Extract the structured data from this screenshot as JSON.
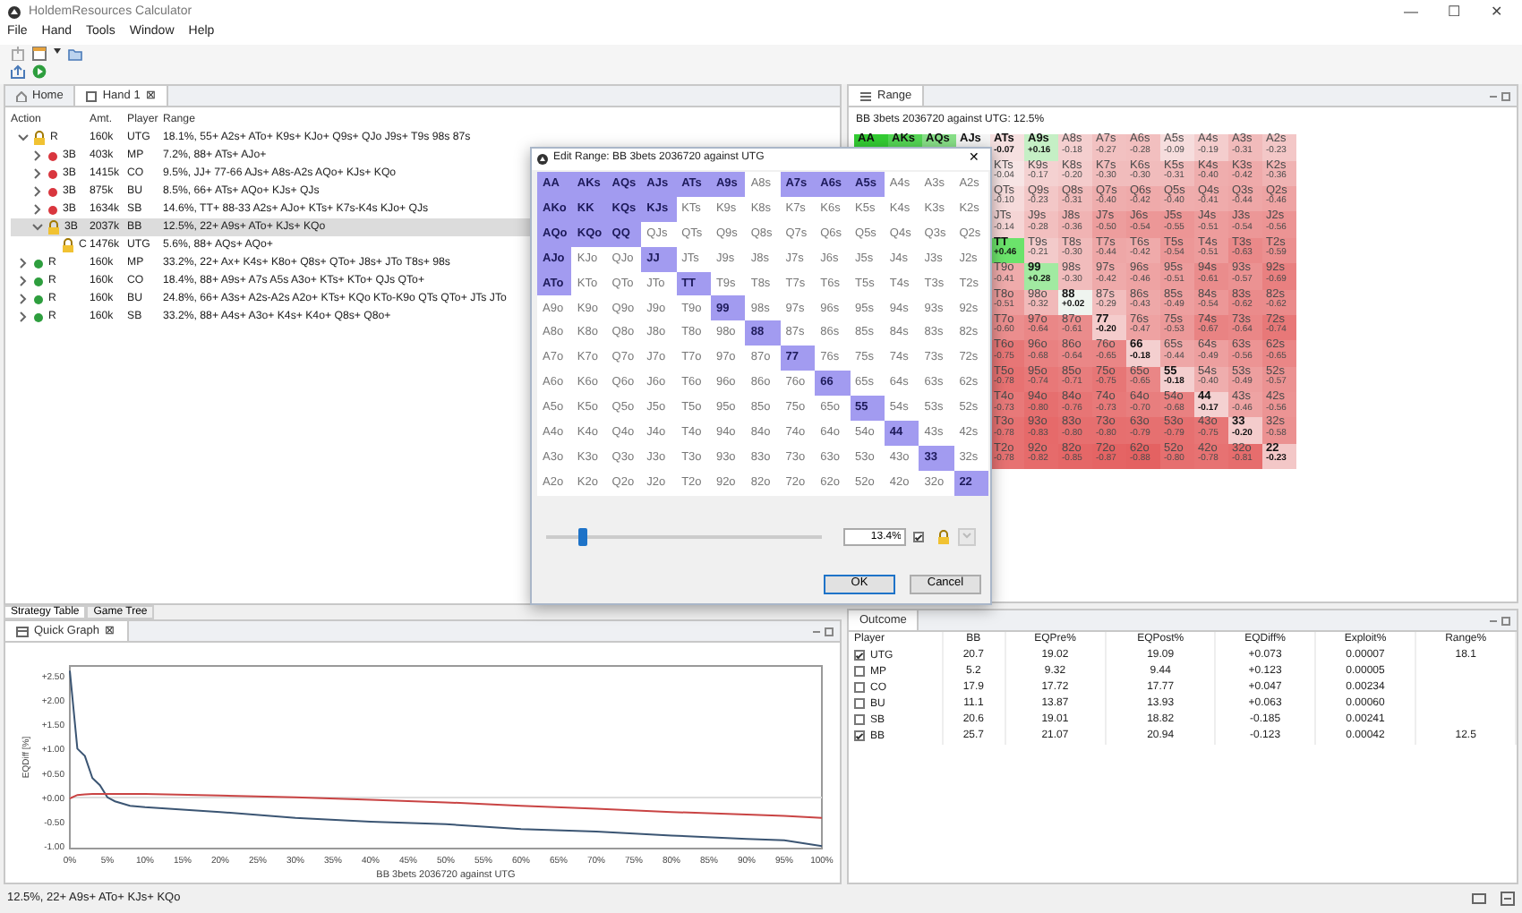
{
  "window": {
    "title": "HoldemResources Calculator",
    "controls": [
      "—",
      "☐",
      "✕"
    ]
  },
  "menu": [
    "File",
    "Hand",
    "Tools",
    "Window",
    "Help"
  ],
  "hand_tabs": [
    {
      "label": "Home",
      "selected": false
    },
    {
      "label": "Hand 1",
      "selected": true,
      "close": "⊠"
    }
  ],
  "tree": {
    "columns": [
      "Action",
      "Amt.",
      "Player",
      "Range"
    ],
    "rows": [
      {
        "action": "R",
        "amount": "160k",
        "player": "UTG",
        "range": "18.1%, 55+ A2s+ ATo+ K9s+ KJo+ Q9s+ QJo J9s+ T9s 98s 87s",
        "kind": "lock",
        "expanded": true,
        "selected": false,
        "children": [
          {
            "action": "3B",
            "amount": "403k",
            "player": "MP",
            "range": "7.2%, 88+ ATs+ AJo+",
            "kind": "dot",
            "color": "#d9363e",
            "expanded": false,
            "selected": false
          },
          {
            "action": "3B",
            "amount": "1415k",
            "player": "CO",
            "range": "9.5%, JJ+ 77-66 AJs+ A8s-A2s AQo+ KJs+ KQo",
            "kind": "dot",
            "color": "#d9363e",
            "expanded": false,
            "selected": false
          },
          {
            "action": "3B",
            "amount": "875k",
            "player": "BU",
            "range": "8.5%, 66+ ATs+ AQo+ KJs+ QJs",
            "kind": "dot",
            "color": "#d9363e",
            "expanded": false,
            "selected": false
          },
          {
            "action": "3B",
            "amount": "1634k",
            "player": "SB",
            "range": "14.6%, TT+ 88-33 A2s+ AJo+ KTs+ K7s-K4s KJo+ QJs",
            "kind": "dot",
            "color": "#d9363e",
            "expanded": false,
            "selected": false
          },
          {
            "action": "3B",
            "amount": "2037k",
            "player": "BB",
            "range": "12.5%, 22+ A9s+ ATo+ KJs+ KQo",
            "kind": "lock",
            "expanded": true,
            "selected": true,
            "children": [
              {
                "action": "C",
                "amount": "1476k",
                "player": "UTG",
                "range": "5.6%, 88+ AQs+ AQo+",
                "kind": "lock",
                "selected": false
              }
            ]
          }
        ]
      },
      {
        "action": "R",
        "amount": "160k",
        "player": "MP",
        "range": "33.2%, 22+ Ax+ K4s+ K8o+ Q8s+ QTo+ J8s+ JTo T8s+ 98s",
        "kind": "dot",
        "color": "#2e9e3e",
        "expanded": false,
        "selected": false
      },
      {
        "action": "R",
        "amount": "160k",
        "player": "CO",
        "range": "18.4%, 88+ A9s+ A7s A5s A3o+ KTs+ KTo+ QJs QTo+",
        "kind": "dot",
        "color": "#2e9e3e",
        "expanded": false,
        "selected": false
      },
      {
        "action": "R",
        "amount": "160k",
        "player": "BU",
        "range": "24.8%, 66+ A3s+ A2s-A2s A2o+ KTs+ KQo KTo-K9o QTs QTo+ JTs JTo",
        "kind": "dot",
        "color": "#2e9e3e",
        "expanded": false,
        "selected": false
      },
      {
        "action": "R",
        "amount": "160k",
        "player": "SB",
        "range": "33.2%, 88+ A4s+ A3o+ K4s+ K4o+ Q8s+ Q8o+",
        "kind": "dot",
        "color": "#2e9e3e",
        "expanded": false,
        "selected": false
      }
    ]
  },
  "bottom_tabs": [
    {
      "label": "Strategy Table",
      "selected": true
    },
    {
      "label": "Game Tree",
      "selected": false
    }
  ],
  "quick_graph": {
    "tab": "Quick Graph",
    "close": "⊠",
    "chart_data": {
      "type": "line",
      "xlabel": "BB 3bets 2036720 against UTG",
      "ylabel": "EQDiff [%]",
      "x": [
        0,
        1,
        2,
        3,
        4,
        5,
        6,
        8,
        10,
        20,
        30,
        40,
        50,
        60,
        70,
        80,
        90,
        95,
        100
      ],
      "series": [
        {
          "color": "#3b5573",
          "values": [
            2.6,
            1.0,
            0.85,
            0.4,
            0.25,
            0.0,
            -0.08,
            -0.17,
            -0.2,
            -0.3,
            -0.42,
            -0.5,
            -0.55,
            -0.65,
            -0.7,
            -0.78,
            -0.85,
            -0.88,
            -1.0
          ]
        },
        {
          "color": "#c94444",
          "values": [
            -0.02,
            0.05,
            0.06,
            0.07,
            0.07,
            0.07,
            0.07,
            0.07,
            0.07,
            0.04,
            0.0,
            -0.05,
            -0.1,
            -0.17,
            -0.23,
            -0.3,
            -0.35,
            -0.38,
            -0.42
          ]
        }
      ],
      "xlim": [
        0,
        100
      ],
      "ylim": [
        -1.05,
        2.7
      ],
      "xticks": [
        {
          "value": 0,
          "label": "0%"
        },
        {
          "value": 5,
          "label": "5%"
        },
        {
          "value": 10,
          "label": "10%"
        },
        {
          "value": 15,
          "label": "15%"
        },
        {
          "value": 20,
          "label": "20%"
        },
        {
          "value": 25,
          "label": "25%"
        },
        {
          "value": 30,
          "label": "30%"
        },
        {
          "value": 35,
          "label": "35%"
        },
        {
          "value": 40,
          "label": "40%"
        },
        {
          "value": 45,
          "label": "45%"
        },
        {
          "value": 50,
          "label": "50%"
        },
        {
          "value": 55,
          "label": "55%"
        },
        {
          "value": 60,
          "label": "60%"
        },
        {
          "value": 65,
          "label": "65%"
        },
        {
          "value": 70,
          "label": "70%"
        },
        {
          "value": 75,
          "label": "75%"
        },
        {
          "value": 80,
          "label": "80%"
        },
        {
          "value": 85,
          "label": "85%"
        },
        {
          "value": 90,
          "label": "90%"
        },
        {
          "value": 95,
          "label": "95%"
        },
        {
          "value": 100,
          "label": "100%"
        }
      ],
      "yticks": [
        {
          "value": 2.5,
          "label": "+2.50"
        },
        {
          "value": 2.0,
          "label": "+2.00"
        },
        {
          "value": 1.5,
          "label": "+1.50"
        },
        {
          "value": 1.0,
          "label": "+1.00"
        },
        {
          "value": 0.5,
          "label": "+0.50"
        },
        {
          "value": 0,
          "label": "+0.00"
        },
        {
          "value": -0.5,
          "label": "-0.50"
        },
        {
          "value": -1.0,
          "label": "-1.00"
        }
      ]
    }
  },
  "range_panel": {
    "tab": "Range",
    "caption": "BB 3bets 2036720 against UTG: 12.5%",
    "rows": [
      [
        {
          "hand": "AA",
          "in_range": true,
          "color": "#33cc33"
        },
        {
          "hand": "AKs",
          "in_range": true,
          "color": "#55d655"
        },
        {
          "hand": "AQs",
          "in_range": true,
          "color": "#88e088"
        },
        {
          "hand": "AJs",
          "in_range": true,
          "color": "#f5f5f5"
        },
        {
          "hand": "ATs",
          "in_range": true,
          "value": "-0.07"
        },
        {
          "hand": "A9s",
          "in_range": true,
          "value": "+0.16"
        },
        {
          "hand": "A8s",
          "in_range": false,
          "value": "-0.18"
        },
        {
          "hand": "A7s",
          "in_range": false,
          "value": "-0.27"
        },
        {
          "hand": "A6s",
          "in_range": false,
          "value": "-0.28"
        },
        {
          "hand": "A5s",
          "in_range": false,
          "value": "-0.09"
        },
        {
          "hand": "A4s",
          "in_range": false,
          "value": "-0.19"
        },
        {
          "hand": "A3s",
          "in_range": false,
          "value": "-0.31"
        },
        {
          "hand": "A2s",
          "in_range": false,
          "value": "-0.23"
        }
      ],
      [
        "",
        "",
        "",
        "",
        {
          "hand": "KTs",
          "in_range": false,
          "value": "-0.04"
        },
        {
          "hand": "K9s",
          "in_range": false,
          "value": "-0.17"
        },
        {
          "hand": "K8s",
          "in_range": false,
          "value": "-0.20"
        },
        {
          "hand": "K7s",
          "in_range": false,
          "value": "-0.30"
        },
        {
          "hand": "K6s",
          "in_range": false,
          "value": "-0.30"
        },
        {
          "hand": "K5s",
          "in_range": false,
          "value": "-0.31"
        },
        {
          "hand": "K4s",
          "in_range": false,
          "value": "-0.40"
        },
        {
          "hand": "K3s",
          "in_range": false,
          "value": "-0.42"
        },
        {
          "hand": "K2s",
          "in_range": false,
          "value": "-0.36"
        }
      ],
      [
        "",
        "",
        "",
        "",
        {
          "hand": "QTs",
          "in_range": false,
          "value": "-0.10"
        },
        {
          "hand": "Q9s",
          "in_range": false,
          "value": "-0.23"
        },
        {
          "hand": "Q8s",
          "in_range": false,
          "value": "-0.31"
        },
        {
          "hand": "Q7s",
          "in_range": false,
          "value": "-0.40"
        },
        {
          "hand": "Q6s",
          "in_range": false,
          "value": "-0.42"
        },
        {
          "hand": "Q5s",
          "in_range": false,
          "value": "-0.40"
        },
        {
          "hand": "Q4s",
          "in_range": false,
          "value": "-0.41"
        },
        {
          "hand": "Q3s",
          "in_range": false,
          "value": "-0.44"
        },
        {
          "hand": "Q2s",
          "in_range": false,
          "value": "-0.46"
        }
      ],
      [
        "",
        "",
        "",
        "",
        {
          "hand": "JTs",
          "in_range": false,
          "value": "-0.14"
        },
        {
          "hand": "J9s",
          "in_range": false,
          "value": "-0.28"
        },
        {
          "hand": "J8s",
          "in_range": false,
          "value": "-0.36"
        },
        {
          "hand": "J7s",
          "in_range": false,
          "value": "-0.50"
        },
        {
          "hand": "J6s",
          "in_range": false,
          "value": "-0.54"
        },
        {
          "hand": "J5s",
          "in_range": false,
          "value": "-0.55"
        },
        {
          "hand": "J4s",
          "in_range": false,
          "value": "-0.51"
        },
        {
          "hand": "J3s",
          "in_range": false,
          "value": "-0.54"
        },
        {
          "hand": "J2s",
          "in_range": false,
          "value": "-0.56"
        }
      ],
      [
        "",
        "",
        "",
        "",
        {
          "hand": "TT",
          "in_range": true,
          "value": "+0.46"
        },
        {
          "hand": "T9s",
          "in_range": false,
          "value": "-0.21"
        },
        {
          "hand": "T8s",
          "in_range": false,
          "value": "-0.30"
        },
        {
          "hand": "T7s",
          "in_range": false,
          "value": "-0.44"
        },
        {
          "hand": "T6s",
          "in_range": false,
          "value": "-0.42"
        },
        {
          "hand": "T5s",
          "in_range": false,
          "value": "-0.54"
        },
        {
          "hand": "T4s",
          "in_range": false,
          "value": "-0.51"
        },
        {
          "hand": "T3s",
          "in_range": false,
          "value": "-0.63"
        },
        {
          "hand": "T2s",
          "in_range": false,
          "value": "-0.59"
        }
      ],
      [
        "",
        "",
        "",
        "",
        {
          "hand": "T9o",
          "in_range": false,
          "value": "-0.41"
        },
        {
          "hand": "99",
          "in_range": true,
          "value": "+0.28"
        },
        {
          "hand": "98s",
          "in_range": false,
          "value": "-0.30"
        },
        {
          "hand": "97s",
          "in_range": false,
          "value": "-0.42"
        },
        {
          "hand": "96s",
          "in_range": false,
          "value": "-0.46"
        },
        {
          "hand": "95s",
          "in_range": false,
          "value": "-0.51"
        },
        {
          "hand": "94s",
          "in_range": false,
          "value": "-0.61"
        },
        {
          "hand": "93s",
          "in_range": false,
          "value": "-0.57"
        },
        {
          "hand": "92s",
          "in_range": false,
          "value": "-0.69"
        }
      ],
      [
        "",
        "",
        "",
        "",
        {
          "hand": "T8o",
          "in_range": false,
          "value": "-0.51"
        },
        {
          "hand": "98o",
          "in_range": false,
          "value": "-0.32"
        },
        {
          "hand": "88",
          "in_range": true,
          "value": "+0.02"
        },
        {
          "hand": "87s",
          "in_range": false,
          "value": "-0.29"
        },
        {
          "hand": "86s",
          "in_range": false,
          "value": "-0.43"
        },
        {
          "hand": "85s",
          "in_range": false,
          "value": "-0.49"
        },
        {
          "hand": "84s",
          "in_range": false,
          "value": "-0.54"
        },
        {
          "hand": "83s",
          "in_range": false,
          "value": "-0.62"
        },
        {
          "hand": "82s",
          "in_range": false,
          "value": "-0.62"
        }
      ],
      [
        "",
        "",
        "",
        "",
        {
          "hand": "T7o",
          "in_range": false,
          "value": "-0.60"
        },
        {
          "hand": "97o",
          "in_range": false,
          "value": "-0.64"
        },
        {
          "hand": "87o",
          "in_range": false,
          "value": "-0.61"
        },
        {
          "hand": "77",
          "in_range": true,
          "value": "-0.20"
        },
        {
          "hand": "76s",
          "in_range": false,
          "value": "-0.47"
        },
        {
          "hand": "75s",
          "in_range": false,
          "value": "-0.53"
        },
        {
          "hand": "74s",
          "in_range": false,
          "value": "-0.67"
        },
        {
          "hand": "73s",
          "in_range": false,
          "value": "-0.64"
        },
        {
          "hand": "72s",
          "in_range": false,
          "value": "-0.74"
        }
      ],
      [
        "",
        "",
        "",
        "",
        {
          "hand": "T6o",
          "in_range": false,
          "value": "-0.75"
        },
        {
          "hand": "96o",
          "in_range": false,
          "value": "-0.68"
        },
        {
          "hand": "86o",
          "in_range": false,
          "value": "-0.64"
        },
        {
          "hand": "76o",
          "in_range": false,
          "value": "-0.65"
        },
        {
          "hand": "66",
          "in_range": true,
          "value": "-0.18"
        },
        {
          "hand": "65s",
          "in_range": false,
          "value": "-0.44"
        },
        {
          "hand": "64s",
          "in_range": false,
          "value": "-0.49"
        },
        {
          "hand": "63s",
          "in_range": false,
          "value": "-0.56"
        },
        {
          "hand": "62s",
          "in_range": false,
          "value": "-0.65"
        }
      ],
      [
        "",
        "",
        "",
        "",
        {
          "hand": "T5o",
          "in_range": false,
          "value": "-0.78"
        },
        {
          "hand": "95o",
          "in_range": false,
          "value": "-0.74"
        },
        {
          "hand": "85o",
          "in_range": false,
          "value": "-0.71"
        },
        {
          "hand": "75o",
          "in_range": false,
          "value": "-0.75"
        },
        {
          "hand": "65o",
          "in_range": false,
          "value": "-0.65"
        },
        {
          "hand": "55",
          "in_range": true,
          "value": "-0.18"
        },
        {
          "hand": "54s",
          "in_range": false,
          "value": "-0.40"
        },
        {
          "hand": "53s",
          "in_range": false,
          "value": "-0.49"
        },
        {
          "hand": "52s",
          "in_range": false,
          "value": "-0.57"
        }
      ],
      [
        "",
        "",
        "",
        "",
        {
          "hand": "T4o",
          "in_range": false,
          "value": "-0.73"
        },
        {
          "hand": "94o",
          "in_range": false,
          "value": "-0.80"
        },
        {
          "hand": "84o",
          "in_range": false,
          "value": "-0.76"
        },
        {
          "hand": "74o",
          "in_range": false,
          "value": "-0.73"
        },
        {
          "hand": "64o",
          "in_range": false,
          "value": "-0.70"
        },
        {
          "hand": "54o",
          "in_range": false,
          "value": "-0.68"
        },
        {
          "hand": "44",
          "in_range": true,
          "value": "-0.17"
        },
        {
          "hand": "43s",
          "in_range": false,
          "value": "-0.46"
        },
        {
          "hand": "42s",
          "in_range": false,
          "value": "-0.56"
        }
      ],
      [
        "",
        "",
        "",
        "",
        {
          "hand": "T3o",
          "in_range": false,
          "value": "-0.78"
        },
        {
          "hand": "93o",
          "in_range": false,
          "value": "-0.83"
        },
        {
          "hand": "83o",
          "in_range": false,
          "value": "-0.80"
        },
        {
          "hand": "73o",
          "in_range": false,
          "value": "-0.80"
        },
        {
          "hand": "63o",
          "in_range": false,
          "value": "-0.79"
        },
        {
          "hand": "53o",
          "in_range": false,
          "value": "-0.79"
        },
        {
          "hand": "43o",
          "in_range": false,
          "value": "-0.75"
        },
        {
          "hand": "33",
          "in_range": true,
          "value": "-0.20"
        },
        {
          "hand": "32s",
          "in_range": false,
          "value": "-0.58"
        }
      ],
      [
        "",
        "",
        "",
        "",
        {
          "hand": "T2o",
          "in_range": false,
          "value": "-0.78"
        },
        {
          "hand": "92o",
          "in_range": false,
          "value": "-0.82"
        },
        {
          "hand": "82o",
          "in_range": false,
          "value": "-0.85"
        },
        {
          "hand": "72o",
          "in_range": false,
          "value": "-0.87"
        },
        {
          "hand": "62o",
          "in_range": false,
          "value": "-0.88"
        },
        {
          "hand": "52o",
          "in_range": false,
          "value": "-0.80"
        },
        {
          "hand": "42o",
          "in_range": false,
          "value": "-0.78"
        },
        {
          "hand": "32o",
          "in_range": false,
          "value": "-0.81"
        },
        {
          "hand": "22",
          "in_range": true,
          "value": "-0.23"
        }
      ]
    ]
  },
  "outcome": {
    "tab": "Outcome",
    "columns": [
      "Player",
      "BB",
      "EQPre%",
      "EQPost%",
      "EQDiff%",
      "Exploit%",
      "Range%"
    ],
    "rows": [
      {
        "checked": true,
        "cells": [
          "UTG",
          "20.7",
          "19.02",
          "19.09",
          "+0.073",
          "0.00007",
          "18.1"
        ]
      },
      {
        "checked": false,
        "cells": [
          "MP",
          "5.2",
          "9.32",
          "9.44",
          "+0.123",
          "0.00005",
          ""
        ]
      },
      {
        "checked": false,
        "cells": [
          "CO",
          "17.9",
          "17.72",
          "17.77",
          "+0.047",
          "0.00234",
          ""
        ]
      },
      {
        "checked": false,
        "cells": [
          "BU",
          "11.1",
          "13.87",
          "13.93",
          "+0.063",
          "0.00060",
          ""
        ]
      },
      {
        "checked": false,
        "cells": [
          "SB",
          "20.6",
          "19.01",
          "18.82",
          "-0.185",
          "0.00241",
          ""
        ]
      },
      {
        "checked": true,
        "cells": [
          "BB",
          "25.7",
          "21.07",
          "20.94",
          "-0.123",
          "0.00042",
          "12.5"
        ]
      }
    ]
  },
  "status_bar": "12.5%, 22+ A9s+ ATo+ KJs+ KQo",
  "dialog": {
    "title": "Edit Range: BB 3bets 2036720 against UTG",
    "close": "✕",
    "grid": [
      [
        {
          "hand": "AA",
          "selected": true
        },
        {
          "hand": "AKs",
          "selected": true
        },
        {
          "hand": "AQs",
          "selected": true
        },
        {
          "hand": "AJs",
          "selected": true
        },
        {
          "hand": "ATs",
          "selected": true
        },
        {
          "hand": "A9s",
          "selected": true
        },
        {
          "hand": "A8s",
          "selected": false
        },
        {
          "hand": "A7s",
          "selected": true
        },
        {
          "hand": "A6s",
          "selected": true
        },
        {
          "hand": "A5s",
          "selected": true
        },
        {
          "hand": "A4s",
          "selected": false
        },
        {
          "hand": "A3s",
          "selected": false
        },
        {
          "hand": "A2s",
          "selected": false
        }
      ],
      [
        {
          "hand": "AKo",
          "selected": true
        },
        {
          "hand": "KK",
          "selected": true
        },
        {
          "hand": "KQs",
          "selected": true
        },
        {
          "hand": "KJs",
          "selected": true
        },
        {
          "hand": "KTs",
          "selected": false
        },
        {
          "hand": "K9s",
          "selected": false
        },
        {
          "hand": "K8s",
          "selected": false
        },
        {
          "hand": "K7s",
          "selected": false
        },
        {
          "hand": "K6s",
          "selected": false
        },
        {
          "hand": "K5s",
          "selected": false
        },
        {
          "hand": "K4s",
          "selected": false
        },
        {
          "hand": "K3s",
          "selected": false
        },
        {
          "hand": "K2s",
          "selected": false
        }
      ],
      [
        {
          "hand": "AQo",
          "selected": true
        },
        {
          "hand": "KQo",
          "selected": true
        },
        {
          "hand": "QQ",
          "selected": true
        },
        {
          "hand": "QJs",
          "selected": false
        },
        {
          "hand": "QTs",
          "selected": false
        },
        {
          "hand": "Q9s",
          "selected": false
        },
        {
          "hand": "Q8s",
          "selected": false
        },
        {
          "hand": "Q7s",
          "selected": false
        },
        {
          "hand": "Q6s",
          "selected": false
        },
        {
          "hand": "Q5s",
          "selected": false
        },
        {
          "hand": "Q4s",
          "selected": false
        },
        {
          "hand": "Q3s",
          "selected": false
        },
        {
          "hand": "Q2s",
          "selected": false
        }
      ],
      [
        {
          "hand": "AJo",
          "selected": true
        },
        {
          "hand": "KJo",
          "selected": false
        },
        {
          "hand": "QJo",
          "selected": false
        },
        {
          "hand": "JJ",
          "selected": true
        },
        {
          "hand": "JTs",
          "selected": false
        },
        {
          "hand": "J9s",
          "selected": false
        },
        {
          "hand": "J8s",
          "selected": false
        },
        {
          "hand": "J7s",
          "selected": false
        },
        {
          "hand": "J6s",
          "selected": false
        },
        {
          "hand": "J5s",
          "selected": false
        },
        {
          "hand": "J4s",
          "selected": false
        },
        {
          "hand": "J3s",
          "selected": false
        },
        {
          "hand": "J2s",
          "selected": false
        }
      ],
      [
        {
          "hand": "ATo",
          "selected": true
        },
        {
          "hand": "KTo",
          "selected": false
        },
        {
          "hand": "QTo",
          "selected": false
        },
        {
          "hand": "JTo",
          "selected": false
        },
        {
          "hand": "TT",
          "selected": true
        },
        {
          "hand": "T9s",
          "selected": false
        },
        {
          "hand": "T8s",
          "selected": false
        },
        {
          "hand": "T7s",
          "selected": false
        },
        {
          "hand": "T6s",
          "selected": false
        },
        {
          "hand": "T5s",
          "selected": false
        },
        {
          "hand": "T4s",
          "selected": false
        },
        {
          "hand": "T3s",
          "selected": false
        },
        {
          "hand": "T2s",
          "selected": false
        }
      ],
      [
        {
          "hand": "A9o",
          "selected": false
        },
        {
          "hand": "K9o",
          "selected": false
        },
        {
          "hand": "Q9o",
          "selected": false
        },
        {
          "hand": "J9o",
          "selected": false
        },
        {
          "hand": "T9o",
          "selected": false
        },
        {
          "hand": "99",
          "selected": true
        },
        {
          "hand": "98s",
          "selected": false
        },
        {
          "hand": "97s",
          "selected": false
        },
        {
          "hand": "96s",
          "selected": false
        },
        {
          "hand": "95s",
          "selected": false
        },
        {
          "hand": "94s",
          "selected": false
        },
        {
          "hand": "93s",
          "selected": false
        },
        {
          "hand": "92s",
          "selected": false
        }
      ],
      [
        {
          "hand": "A8o",
          "selected": false
        },
        {
          "hand": "K8o",
          "selected": false
        },
        {
          "hand": "Q8o",
          "selected": false
        },
        {
          "hand": "J8o",
          "selected": false
        },
        {
          "hand": "T8o",
          "selected": false
        },
        {
          "hand": "98o",
          "selected": false
        },
        {
          "hand": "88",
          "selected": true
        },
        {
          "hand": "87s",
          "selected": false
        },
        {
          "hand": "86s",
          "selected": false
        },
        {
          "hand": "85s",
          "selected": false
        },
        {
          "hand": "84s",
          "selected": false
        },
        {
          "hand": "83s",
          "selected": false
        },
        {
          "hand": "82s",
          "selected": false
        }
      ],
      [
        {
          "hand": "A7o",
          "selected": false
        },
        {
          "hand": "K7o",
          "selected": false
        },
        {
          "hand": "Q7o",
          "selected": false
        },
        {
          "hand": "J7o",
          "selected": false
        },
        {
          "hand": "T7o",
          "selected": false
        },
        {
          "hand": "97o",
          "selected": false
        },
        {
          "hand": "87o",
          "selected": false
        },
        {
          "hand": "77",
          "selected": true
        },
        {
          "hand": "76s",
          "selected": false
        },
        {
          "hand": "75s",
          "selected": false
        },
        {
          "hand": "74s",
          "selected": false
        },
        {
          "hand": "73s",
          "selected": false
        },
        {
          "hand": "72s",
          "selected": false
        }
      ],
      [
        {
          "hand": "A6o",
          "selected": false
        },
        {
          "hand": "K6o",
          "selected": false
        },
        {
          "hand": "Q6o",
          "selected": false
        },
        {
          "hand": "J6o",
          "selected": false
        },
        {
          "hand": "T6o",
          "selected": false
        },
        {
          "hand": "96o",
          "selected": false
        },
        {
          "hand": "86o",
          "selected": false
        },
        {
          "hand": "76o",
          "selected": false
        },
        {
          "hand": "66",
          "selected": true
        },
        {
          "hand": "65s",
          "selected": false
        },
        {
          "hand": "64s",
          "selected": false
        },
        {
          "hand": "63s",
          "selected": false
        },
        {
          "hand": "62s",
          "selected": false
        }
      ],
      [
        {
          "hand": "A5o",
          "selected": false
        },
        {
          "hand": "K5o",
          "selected": false
        },
        {
          "hand": "Q5o",
          "selected": false
        },
        {
          "hand": "J5o",
          "selected": false
        },
        {
          "hand": "T5o",
          "selected": false
        },
        {
          "hand": "95o",
          "selected": false
        },
        {
          "hand": "85o",
          "selected": false
        },
        {
          "hand": "75o",
          "selected": false
        },
        {
          "hand": "65o",
          "selected": false
        },
        {
          "hand": "55",
          "selected": true
        },
        {
          "hand": "54s",
          "selected": false
        },
        {
          "hand": "53s",
          "selected": false
        },
        {
          "hand": "52s",
          "selected": false
        }
      ],
      [
        {
          "hand": "A4o",
          "selected": false
        },
        {
          "hand": "K4o",
          "selected": false
        },
        {
          "hand": "Q4o",
          "selected": false
        },
        {
          "hand": "J4o",
          "selected": false
        },
        {
          "hand": "T4o",
          "selected": false
        },
        {
          "hand": "94o",
          "selected": false
        },
        {
          "hand": "84o",
          "selected": false
        },
        {
          "hand": "74o",
          "selected": false
        },
        {
          "hand": "64o",
          "selected": false
        },
        {
          "hand": "54o",
          "selected": false
        },
        {
          "hand": "44",
          "selected": true
        },
        {
          "hand": "43s",
          "selected": false
        },
        {
          "hand": "42s",
          "selected": false
        }
      ],
      [
        {
          "hand": "A3o",
          "selected": false
        },
        {
          "hand": "K3o",
          "selected": false
        },
        {
          "hand": "Q3o",
          "selected": false
        },
        {
          "hand": "J3o",
          "selected": false
        },
        {
          "hand": "T3o",
          "selected": false
        },
        {
          "hand": "93o",
          "selected": false
        },
        {
          "hand": "83o",
          "selected": false
        },
        {
          "hand": "73o",
          "selected": false
        },
        {
          "hand": "63o",
          "selected": false
        },
        {
          "hand": "53o",
          "selected": false
        },
        {
          "hand": "43o",
          "selected": false
        },
        {
          "hand": "33",
          "selected": true
        },
        {
          "hand": "32s",
          "selected": false
        }
      ],
      [
        {
          "hand": "A2o",
          "selected": false
        },
        {
          "hand": "K2o",
          "selected": false
        },
        {
          "hand": "Q2o",
          "selected": false
        },
        {
          "hand": "J2o",
          "selected": false
        },
        {
          "hand": "T2o",
          "selected": false
        },
        {
          "hand": "92o",
          "selected": false
        },
        {
          "hand": "82o",
          "selected": false
        },
        {
          "hand": "72o",
          "selected": false
        },
        {
          "hand": "62o",
          "selected": false
        },
        {
          "hand": "52o",
          "selected": false
        },
        {
          "hand": "42o",
          "selected": false
        },
        {
          "hand": "32o",
          "selected": false
        },
        {
          "hand": "22",
          "selected": true
        }
      ]
    ],
    "slider": {
      "level": 0.13
    },
    "percent": "13.4%",
    "lock_checked": true,
    "buttons": [
      {
        "label": "OK",
        "default": true
      },
      {
        "label": "Cancel",
        "default": false
      }
    ]
  }
}
